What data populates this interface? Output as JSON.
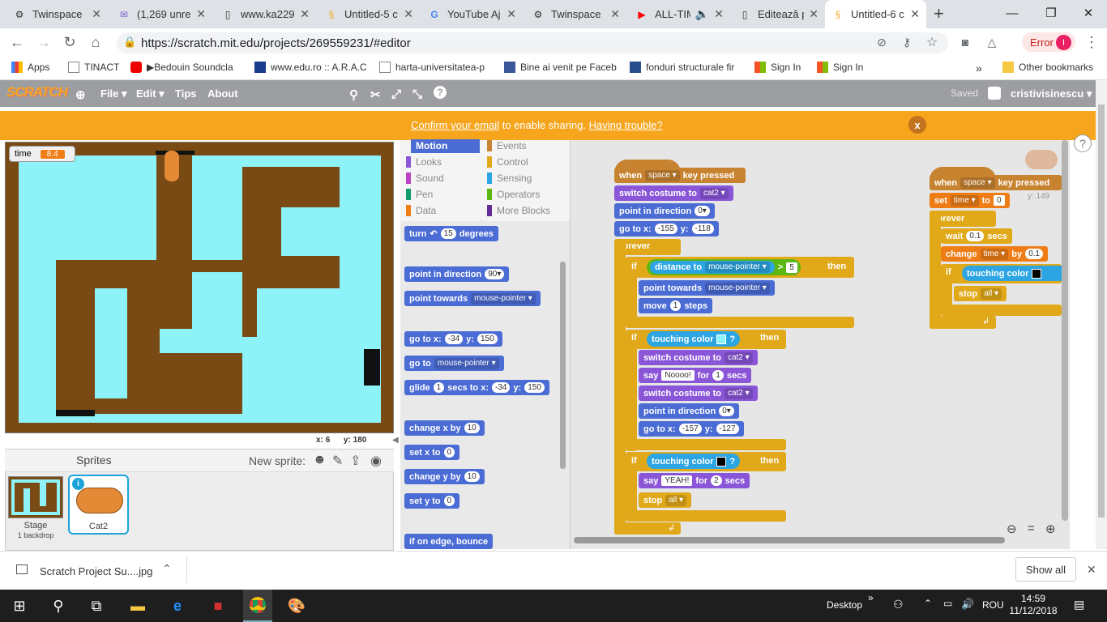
{
  "browser": {
    "tabs": [
      {
        "title": "Twinspace"
      },
      {
        "title": "(1,269 unre"
      },
      {
        "title": "www.ka229"
      },
      {
        "title": "Untitled-5 c"
      },
      {
        "title": "YouTube Aj"
      },
      {
        "title": "Twinspace"
      },
      {
        "title": "ALL-TIM"
      },
      {
        "title": "Editează pa"
      },
      {
        "title": "Untitled-6 c"
      }
    ],
    "url": "https://scratch.mit.edu/projects/269559231/#editor",
    "error_label": "Error",
    "profile_initial": "I",
    "bookmarks": [
      "Apps",
      "TINACT",
      "Bedouin Soundcla",
      "www.edu.ro :: A.R.A.C",
      "harta-universitatea-p",
      "Bine ai venit pe Faceb",
      "fonduri structurale fir",
      "Sign In",
      "Sign In"
    ],
    "other_bookmarks": "Other bookmarks",
    "more": "»"
  },
  "scratch": {
    "logo": "SCRATCH",
    "menus": [
      "File ▾",
      "Edit ▾",
      "Tips",
      "About"
    ],
    "saved": "Saved",
    "username": "cristivisinescu ▾",
    "banner_link1": "Confirm your email",
    "banner_mid": " to enable sharing. ",
    "banner_link2": "Having trouble?",
    "banner_close": "x",
    "stage_var_name": "time",
    "stage_var_value": "8.4",
    "coords_x_label": "x:",
    "coords_x": "6",
    "coords_y_label": "y:",
    "coords_y": "180",
    "sprites_title": "Sprites",
    "new_sprite": "New sprite:",
    "stage_label": "Stage",
    "stage_backdrops": "1 backdrop",
    "sprite_name": "Cat2",
    "sprite_y_readout": "y: 149",
    "categories": [
      {
        "name": "Motion",
        "color": "#4a6cd4"
      },
      {
        "name": "Looks",
        "color": "#8a55d7"
      },
      {
        "name": "Sound",
        "color": "#bb42c3"
      },
      {
        "name": "Pen",
        "color": "#0e9a6c"
      },
      {
        "name": "Data",
        "color": "#ee7d16"
      },
      {
        "name": "Events",
        "color": "#c88330"
      },
      {
        "name": "Control",
        "color": "#e1a91a"
      },
      {
        "name": "Sensing",
        "color": "#2ca5e2"
      },
      {
        "name": "Operators",
        "color": "#5cb712"
      },
      {
        "name": "More Blocks",
        "color": "#632d99"
      }
    ],
    "palette": {
      "turn": "turn",
      "turn_val": "15",
      "degrees": "degrees",
      "point_dir": "point in direction",
      "point_dir_val": "90▾",
      "point_towards": "point towards",
      "mouse_pointer": "mouse-pointer ▾",
      "goto": "go to x:",
      "goto_x": "-34",
      "y_label": "y:",
      "goto_y": "150",
      "goto_mp": "go to",
      "glide": "glide",
      "glide_secs": "1",
      "secs_to_x": "secs to x:",
      "glide_x": "-34",
      "glide_y": "150",
      "change_x": "change x by",
      "change_x_val": "10",
      "set_x": "set x to",
      "set_x_val": "0",
      "change_y": "change y by",
      "change_y_val": "10",
      "set_y": "set y to",
      "set_y_val": "0",
      "bounce": "if on edge, bounce"
    },
    "script1": {
      "when": "when",
      "key": "space ▾",
      "key_pressed": "key pressed",
      "switch_costume": "switch costume to",
      "costume": "cat2 ▾",
      "point_dir": "point in direction",
      "dir": "0▾",
      "goto": "go to x:",
      "x": "-155",
      "y_label": "y:",
      "y": "-118",
      "forever": "forever",
      "if": "if",
      "distance_to": "distance to",
      "mouse_pointer": "mouse-pointer ▾",
      "gt": ">",
      "dist_val": "5",
      "then": "then",
      "point_towards": "point towards",
      "move": "move",
      "move_val": "1",
      "steps": "steps",
      "touching_color": "touching color",
      "q": "?",
      "say": "say",
      "say_text": "Noooo!",
      "for": "for",
      "say_secs": "1",
      "secs": "secs",
      "dir2": "0▾",
      "x2": "-157",
      "y2": "-127",
      "say_text2": "YEAH!",
      "say_secs2": "2",
      "stop": "stop",
      "stop_val": "all ▾"
    },
    "script2": {
      "when": "when",
      "key": "space ▾",
      "key_pressed": "key pressed",
      "set": "set",
      "var": "time ▾",
      "to": "to",
      "set_val": "0",
      "forever": "forever",
      "wait": "wait",
      "wait_val": "0.1",
      "secs": "secs",
      "change": "change",
      "by": "by",
      "change_val": "0.1",
      "if": "if",
      "touching_color": "touching color",
      "stop": "stop",
      "stop_val": "all ▾"
    }
  },
  "download": {
    "file": "Scratch Project Su....jpg",
    "show_all": "Show all"
  },
  "taskbar": {
    "desktop": "Desktop",
    "lang": "ROU",
    "time": "14:59",
    "date": "11/12/2018"
  }
}
